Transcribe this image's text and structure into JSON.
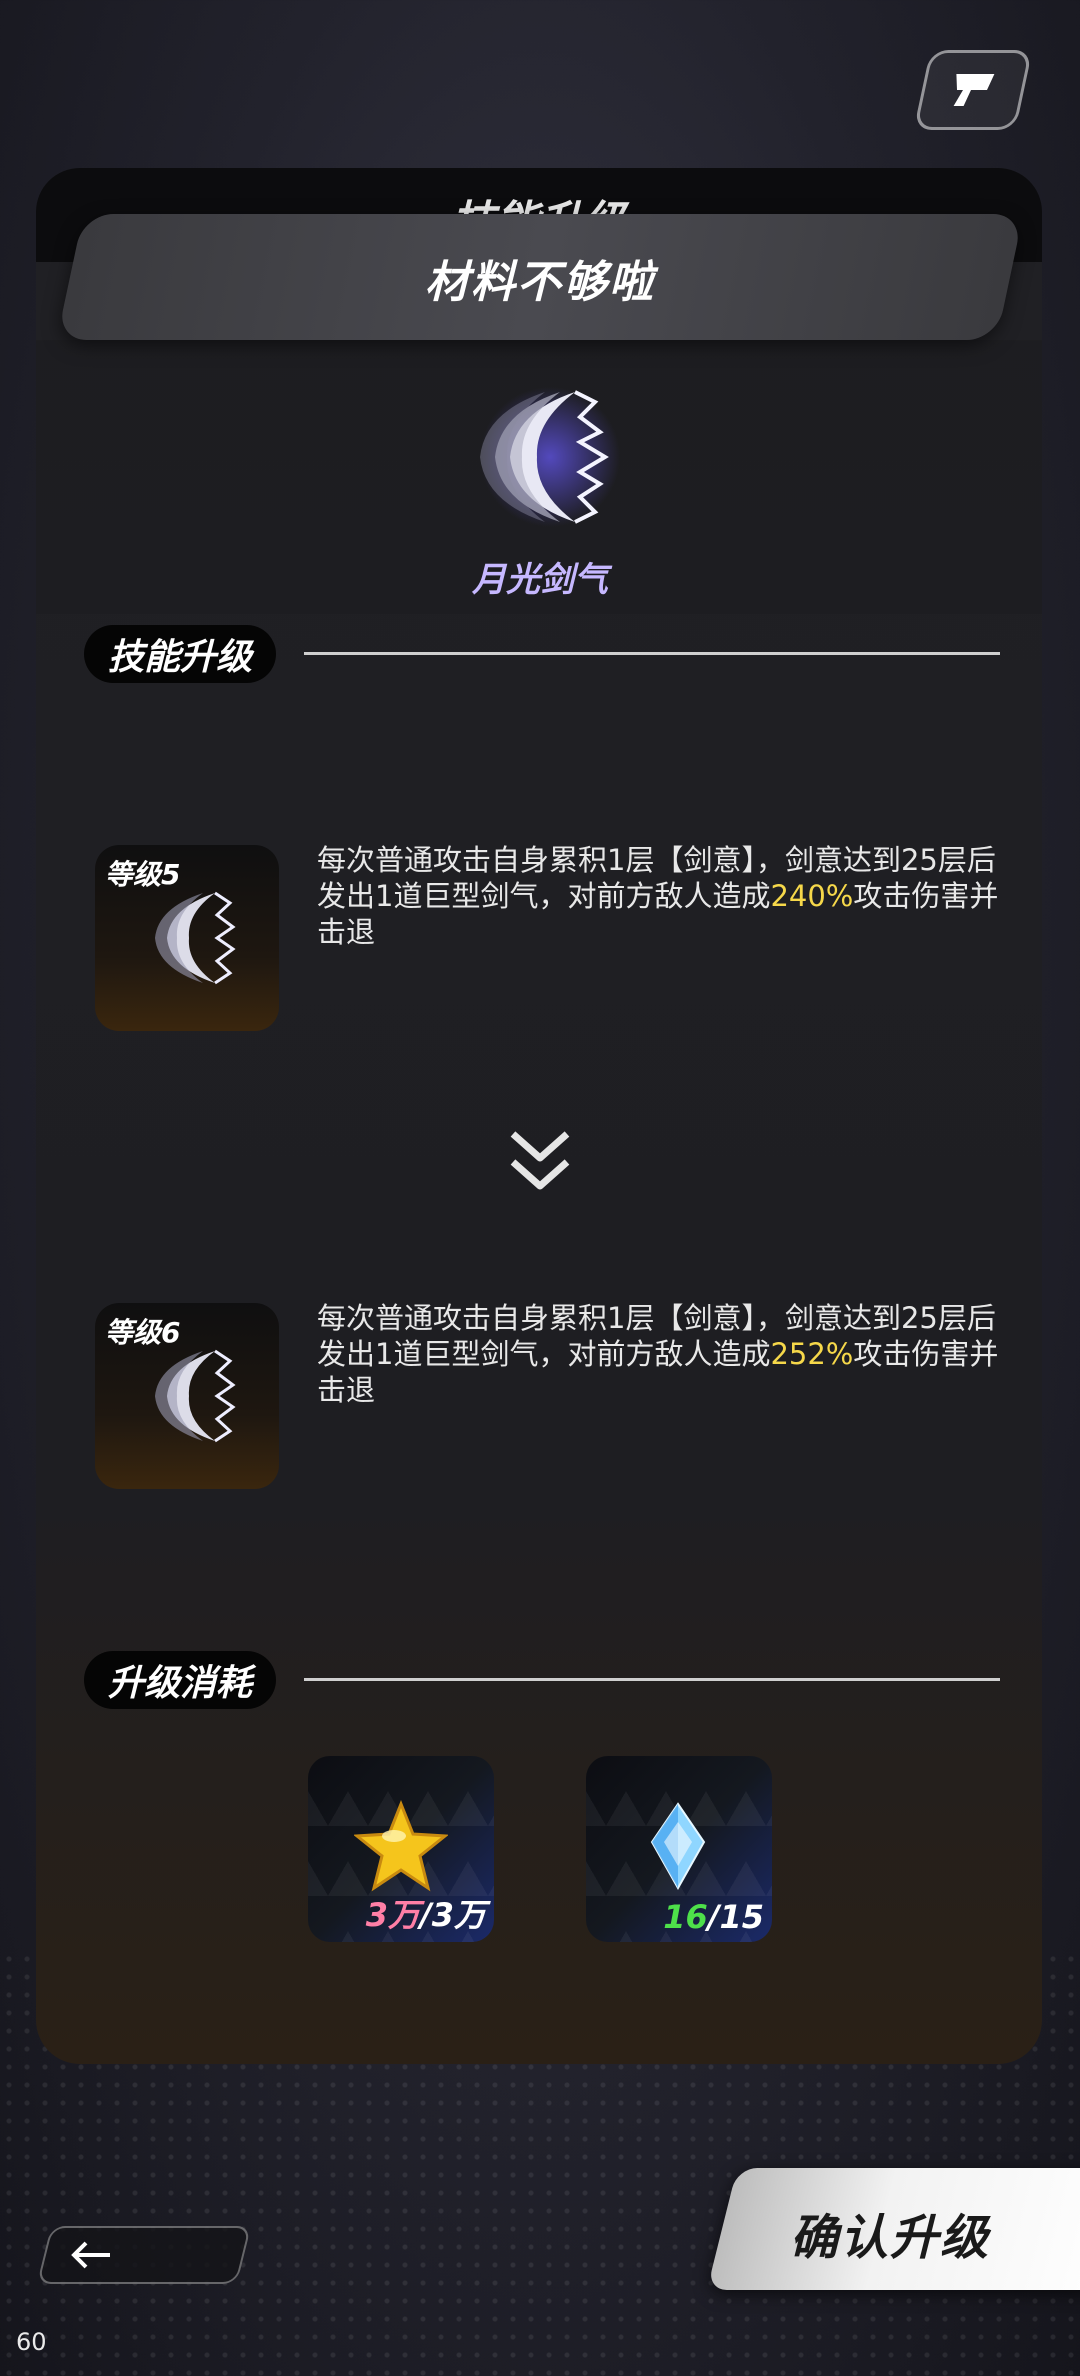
{
  "header": {
    "ghost_title": "技能升级"
  },
  "banner": {
    "title": "材料不够啦"
  },
  "skill": {
    "name": "月光剑气"
  },
  "sections": {
    "upgrade_title": "技能升级",
    "cost_title": "升级消耗"
  },
  "levels": [
    {
      "label": "等级5",
      "desc_pre": "每次普通攻击自身累积1层【剑意】，剑意达到25层后发出1道巨型剑气，对前方敌人造成",
      "desc_value": "240%",
      "desc_post": "攻击伤害并击退"
    },
    {
      "label": "等级6",
      "desc_pre": "每次普通攻击自身累积1层【剑意】，剑意达到25层后发出1道巨型剑气，对前方敌人造成",
      "desc_value": "252%",
      "desc_post": "攻击伤害并击退"
    }
  ],
  "costs": [
    {
      "icon": "star-icon",
      "have": "3万",
      "need": "/3万",
      "have_color": "#ff7fa6"
    },
    {
      "icon": "crystal-icon",
      "have": "16",
      "need": "/15",
      "have_color": "#4ee04a"
    }
  ],
  "buttons": {
    "confirm_label": "确认升级"
  },
  "debug": {
    "fps": "60"
  },
  "colors": {
    "highlight": "#f6d84a",
    "skill_name": "#c6b8ff"
  }
}
